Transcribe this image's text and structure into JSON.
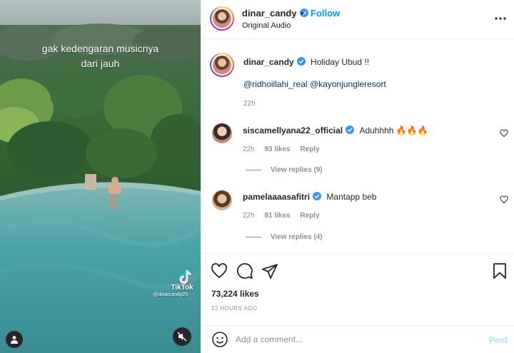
{
  "media": {
    "overlay_line1": "gak kedengaran musicnya",
    "overlay_line2": "dari jauh",
    "watermark_label": "TikTok",
    "watermark_handle": "@dinarcandy25",
    "icons": {
      "user_tag": "user-icon",
      "mute": "speaker-muted-icon",
      "watermark": "tiktok-icon"
    }
  },
  "header": {
    "username": "dinar_candy",
    "verified": true,
    "separator": "•",
    "follow_label": "Follow",
    "audio": "Original Audio",
    "more_icon": "more-horizontal-icon"
  },
  "caption": {
    "username": "dinar_candy",
    "text": "Holiday Ubud !!",
    "tags": "@ridhoillahi_real @kayonjungleresort",
    "time": "22h"
  },
  "comments": [
    {
      "username": "siscamellyana22_official",
      "verified": true,
      "text": "Aduhhhh 🔥🔥🔥",
      "time": "22h",
      "likes": "93 likes",
      "reply_label": "Reply",
      "view_replies": "View replies (9)"
    },
    {
      "username": "pamelaaaasafitri",
      "verified": true,
      "text": "Mantapp beb",
      "time": "22h",
      "likes": "81 likes",
      "reply_label": "Reply",
      "view_replies": "View replies (4)"
    }
  ],
  "actions": {
    "icons": [
      "heart-icon",
      "comment-icon",
      "share-icon",
      "bookmark-icon"
    ],
    "likes": "73,224 likes",
    "posted": "22 HOURS AGO"
  },
  "add_comment": {
    "placeholder": "Add a comment...",
    "post_label": "Post",
    "emoji_icon": "emoji-icon"
  },
  "colors": {
    "accent": "#0095f6",
    "link": "#00376b",
    "muted": "#8e8e8e",
    "post_disabled": "#b2dffc",
    "text": "#262626"
  }
}
